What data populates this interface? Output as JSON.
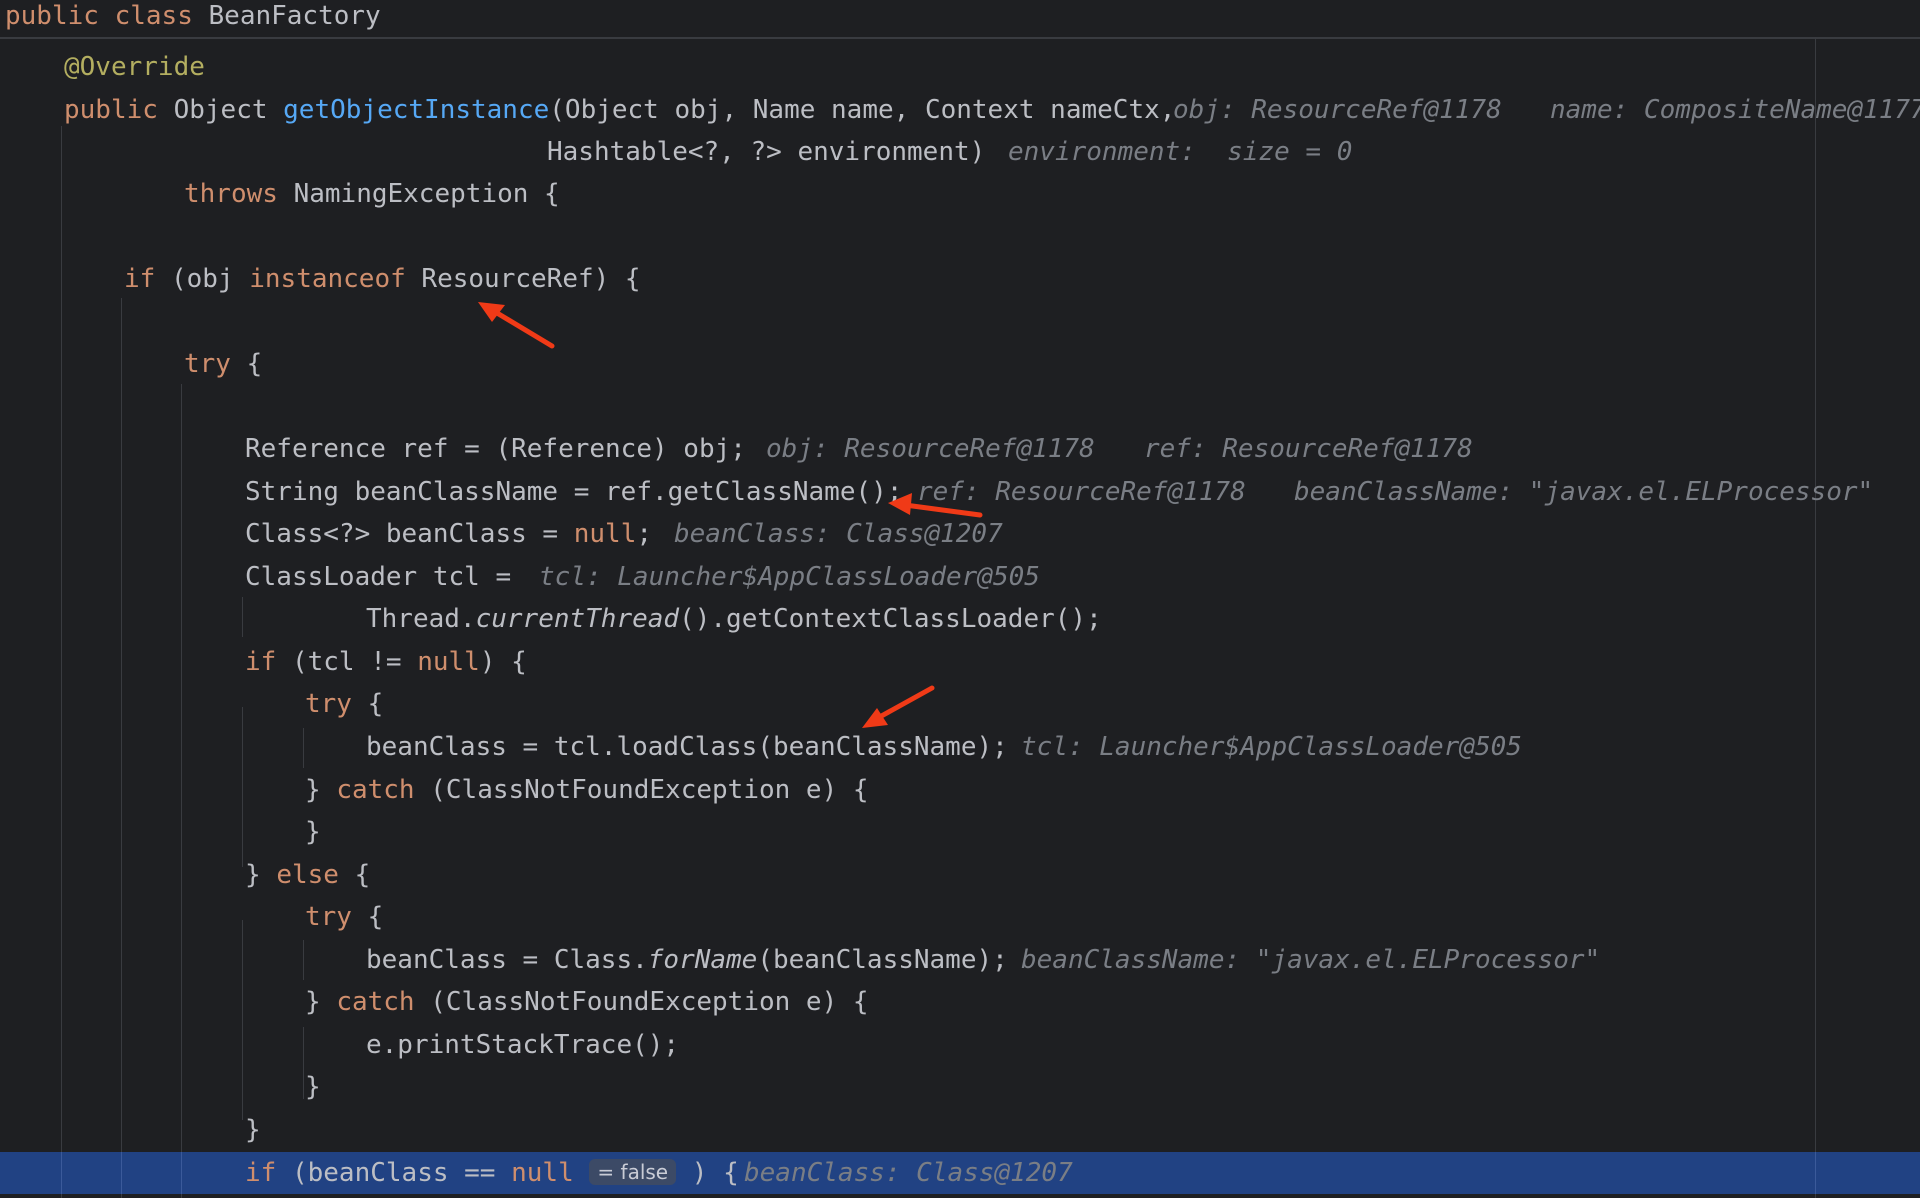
{
  "header": {
    "kw_public": "public",
    "kw_class": "class",
    "class_name": "BeanFactory"
  },
  "code": {
    "annotation": "@Override",
    "l2_public": "public",
    "l2_type": " Object ",
    "l2_method": "getObjectInstance",
    "l2_params": "(Object obj, Name name, Context nameCtx,",
    "l3_params": "Hashtable<?, ?> environment)",
    "l4_throws": "throws",
    "l4_rest": " NamingException {",
    "l5_if": "if",
    "l5_a": " (obj ",
    "l5_instanceof": "instanceof",
    "l5_b": " ResourceRef) {",
    "l6_try": "try",
    "l6_rest": " {",
    "l7": "Reference ref = (Reference) obj;",
    "l8": "String beanClassName = ref.getClassName();",
    "l9_a": "Class<?> beanClass = ",
    "l9_null": "null",
    "l9_b": ";",
    "l10": "ClassLoader tcl =",
    "l11_a": "Thread.",
    "l11_method": "currentThread",
    "l11_b": "().getContextClassLoader();",
    "l12_if": "if",
    "l12_a": " (tcl != ",
    "l12_null": "null",
    "l12_b": ") {",
    "l13_try": "try",
    "l13_rest": " {",
    "l14": "beanClass = tcl.loadClass(beanClassName);",
    "l15_a": "} ",
    "l15_catch": "catch",
    "l15_b": " (ClassNotFoundException e) {",
    "l16": "}",
    "l17_a": "} ",
    "l17_else": "else",
    "l17_b": " {",
    "l18_try": "try",
    "l18_rest": " {",
    "l19_a": "beanClass = Class.",
    "l19_method": "forName",
    "l19_b": "(beanClassName);",
    "l20_a": "} ",
    "l20_catch": "catch",
    "l20_b": " (ClassNotFoundException e) {",
    "l21": "e.printStackTrace();",
    "l22": "}",
    "l23": "}",
    "l24_if": "if",
    "l24_a": " (beanClass == ",
    "l24_null": "null",
    "l24_badge": "= false",
    "l24_b": ") {"
  },
  "hints": {
    "l2_obj": "obj: ResourceRef@1178",
    "l2_name": "name: CompositeName@1177",
    "l3_env": "environment:  size = 0",
    "l7_obj": "obj: ResourceRef@1178",
    "l7_ref": "ref: ResourceRef@1178",
    "l8_ref": "ref: ResourceRef@1178",
    "l8_bcn": "beanClassName: \"javax.el.ELProcessor\"",
    "l9_bc": "beanClass: Class@1207",
    "l10_tcl": "tcl: Launcher$AppClassLoader@505",
    "l14_tcl": "tcl: Launcher$AppClassLoader@505",
    "l19_bcn": "beanClassName: \"javax.el.ELProcessor\"",
    "l24_bc": "beanClass: Class@1207"
  },
  "colors": {
    "background": "#1e1f22",
    "keyword": "#cf8e6d",
    "method": "#56a8f5",
    "annotation": "#b3ae60",
    "inlay_hint": "#7a7e85",
    "execution_line": "#214283",
    "arrow": "#f03a17"
  }
}
